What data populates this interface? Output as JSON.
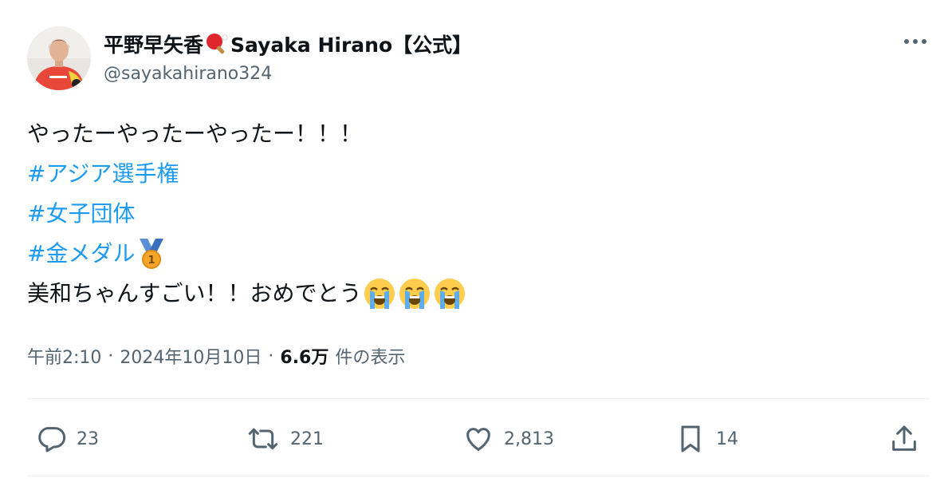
{
  "author": {
    "display_name": "平野早矢香",
    "name_suffix": "Sayaka Hirano【公式】",
    "handle": "@sayakahirano324",
    "avatar_icon": "profile-photo"
  },
  "tweet": {
    "line1": "やったーやったーやったー！！！",
    "hashtag1": "#アジア選手権",
    "hashtag2": "#女子団体",
    "hashtag3": "#金メダル",
    "line5": "美和ちゃんすごい！！おめでとう",
    "emoji_medal": "1st-place-medal-icon",
    "emoji_crying": "loudly-crying-face-icon"
  },
  "meta": {
    "time": "午前2:10",
    "separator": "·",
    "date": "2024年10月10日",
    "views_count": "6.6万",
    "views_label": "件の表示"
  },
  "actions": {
    "replies": "23",
    "reposts": "221",
    "likes": "2,813",
    "bookmarks": "14"
  },
  "colors": {
    "link": "#1d9bf0",
    "text": "#0f1419",
    "secondary": "#536471",
    "divider": "#eff3f4"
  }
}
